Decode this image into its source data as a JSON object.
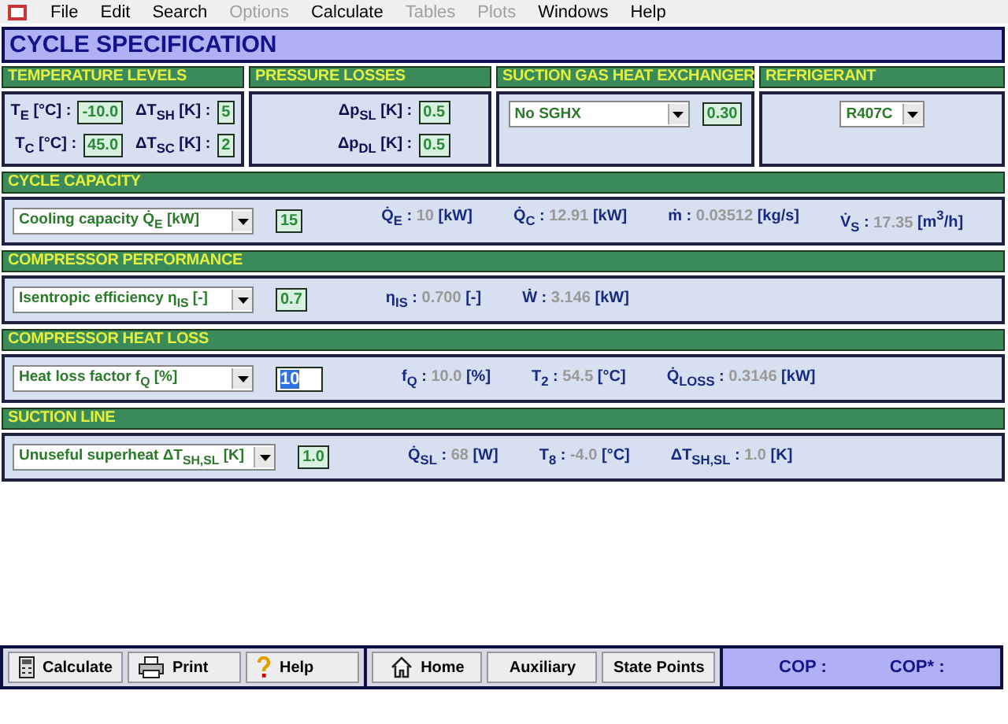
{
  "menu": [
    {
      "label": "File",
      "disabled": false
    },
    {
      "label": "Edit",
      "disabled": false
    },
    {
      "label": "Search",
      "disabled": false
    },
    {
      "label": "Options",
      "disabled": true
    },
    {
      "label": "Calculate",
      "disabled": false
    },
    {
      "label": "Tables",
      "disabled": true
    },
    {
      "label": "Plots",
      "disabled": true
    },
    {
      "label": "Windows",
      "disabled": false
    },
    {
      "label": "Help",
      "disabled": false
    }
  ],
  "title": "CYCLE SPECIFICATION",
  "top_panels": [
    {
      "header": "TEMPERATURE LEVELS",
      "kind": "fields",
      "fields": [
        {
          "label": "T$_{E}$ [°C] :",
          "value": "-10.0"
        },
        {
          "label": "ΔT$_{SH}$ [K] :",
          "value": "5"
        },
        {
          "label": "T$_{C}$ [°C] :",
          "value": "45.0"
        },
        {
          "label": "ΔT$_{SC}$ [K] :",
          "value": "2"
        }
      ]
    },
    {
      "header": "PRESSURE LOSSES",
      "kind": "fields",
      "fields": [
        {
          "label": "Δp$_{SL}$ [K] :",
          "value": "0.5"
        },
        {
          "label": "Δp$_{DL}$ [K] :",
          "value": "0.5"
        }
      ]
    },
    {
      "header": "SUCTION GAS HEAT EXCHANGER",
      "kind": "select",
      "dropdown": "No SGHX",
      "value": "0.30"
    },
    {
      "header": "REFRIGERANT",
      "kind": "select",
      "dropdown": "R407C"
    }
  ],
  "sections": [
    {
      "header": "CYCLE CAPACITY",
      "dropdown": "Cooling capacity Q̇$_{E}$ [kW]",
      "input": "15",
      "selected": false,
      "readouts": [
        {
          "label": "Q̇$_{E}$ :",
          "value": "10",
          "unit": "[kW]"
        },
        {
          "label": "Q̇$_{C}$ :",
          "value": "12.91",
          "unit": "[kW]"
        },
        {
          "label": "ṁ :",
          "value": "0.03512",
          "unit": "[kg/s]"
        },
        {
          "label": "V̇$_{S}$ :",
          "value": "17.35",
          "unit": "[m$^{3}$/h]"
        }
      ]
    },
    {
      "header": "COMPRESSOR PERFORMANCE",
      "dropdown": "Isentropic efficiency η$_{IS}$ [-]",
      "input": "0.7",
      "selected": false,
      "readouts": [
        {
          "label": "η$_{IS}$ :",
          "value": "0.700",
          "unit": "[-]"
        },
        {
          "label": "Ẇ :",
          "value": "3.146",
          "unit": "[kW]"
        }
      ]
    },
    {
      "header": "COMPRESSOR HEAT LOSS",
      "dropdown": "Heat loss factor f$_{Q}$ [%]",
      "input": "10",
      "selected": true,
      "readouts": [
        {
          "label": "f$_{Q}$ :",
          "value": "10.0",
          "unit": "[%]"
        },
        {
          "label": "T$_{2}$ :",
          "value": "54.5",
          "unit": "[°C]"
        },
        {
          "label": "Q̇$_{LOSS}$ :",
          "value": "0.3146",
          "unit": "[kW]"
        }
      ]
    },
    {
      "header": "SUCTION LINE",
      "dropdown": "Unuseful superheat ΔT$_{SH,SL}$ [K]",
      "input": "1.0",
      "selected": false,
      "readouts": [
        {
          "label": "Q̇$_{SL}$ :",
          "value": "68",
          "unit": "[W]"
        },
        {
          "label": "T$_{8}$ :",
          "value": "-4.0",
          "unit": "[°C]"
        },
        {
          "label": "ΔT$_{SH,SL}$ :",
          "value": "1.0",
          "unit": "[K]"
        }
      ]
    }
  ],
  "button_groups": [
    [
      "Calculate",
      "Print",
      "Help"
    ],
    [
      "Home",
      "Auxiliary",
      "State Points"
    ]
  ],
  "cop": [
    "COP :",
    "COP* :"
  ]
}
